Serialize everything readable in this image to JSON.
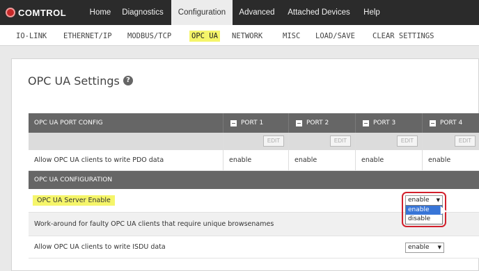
{
  "brand": {
    "logo_text": "COMTROL"
  },
  "topnav": {
    "tabs": [
      {
        "label": "Home"
      },
      {
        "label": "Diagnostics"
      },
      {
        "label": "Configuration"
      },
      {
        "label": "Advanced"
      },
      {
        "label": "Attached Devices"
      },
      {
        "label": "Help"
      }
    ],
    "active": "Configuration"
  },
  "subnav": {
    "items": [
      {
        "label": "IO-LINK"
      },
      {
        "label": "ETHERNET/IP"
      },
      {
        "label": "MODBUS/TCP"
      },
      {
        "label": "OPC UA"
      },
      {
        "label": "NETWORK"
      },
      {
        "label": "MISC"
      },
      {
        "label": "LOAD/SAVE"
      },
      {
        "label": "CLEAR SETTINGS"
      }
    ],
    "active": "OPC UA"
  },
  "page": {
    "title": "OPC UA Settings",
    "help_icon": "question-icon"
  },
  "port_config": {
    "header": "OPC UA PORT CONFIG",
    "ports": [
      {
        "label": "PORT 1",
        "edit": "EDIT"
      },
      {
        "label": "PORT 2",
        "edit": "EDIT"
      },
      {
        "label": "PORT 3",
        "edit": "EDIT"
      },
      {
        "label": "PORT 4",
        "edit": "EDIT"
      }
    ],
    "rows": [
      {
        "label": "Allow OPC UA clients to write PDO data",
        "values": [
          "enable",
          "enable",
          "enable",
          "enable"
        ]
      }
    ]
  },
  "opc_config": {
    "header": "OPC UA CONFIGURATION",
    "rows": [
      {
        "label": "OPC UA Server Enable",
        "value": "enable"
      },
      {
        "label": "Work-around for faulty OPC UA clients that require unique browsenames"
      },
      {
        "label": "Allow OPC UA clients to write ISDU data",
        "value": "enable"
      }
    ],
    "dropdown_options": [
      {
        "label": "enable"
      },
      {
        "label": "disable"
      }
    ],
    "dropdown_selected": "enable"
  },
  "colors": {
    "highlight": "#f5f56a",
    "header_bg": "#666666",
    "topnav_bg": "#2b2b2b",
    "outline_red": "#d21f2b",
    "option_selected": "#3875d7"
  }
}
